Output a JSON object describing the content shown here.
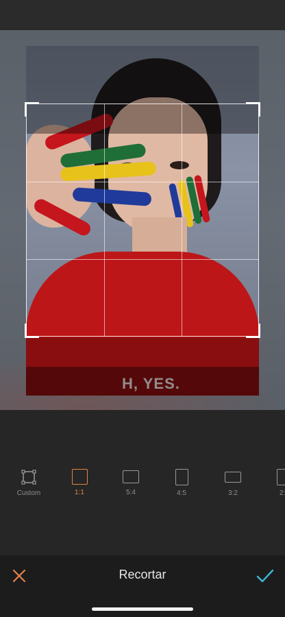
{
  "editor": {
    "photo_caption": "H, YES."
  },
  "ratios": [
    {
      "label": "Custom",
      "icon": "custom-crop-icon",
      "active": false
    },
    {
      "label": "1:1",
      "icon": "square-icon",
      "active": true
    },
    {
      "label": "5:4",
      "icon": "ratio-5-4-icon",
      "active": false
    },
    {
      "label": "4:5",
      "icon": "ratio-4-5-icon",
      "active": false
    },
    {
      "label": "3:2",
      "icon": "ratio-3-2-icon",
      "active": false
    },
    {
      "label": "2:",
      "icon": "ratio-2-3-icon",
      "active": false
    }
  ],
  "bottom_bar": {
    "title": "Recortar",
    "cancel_icon": "close-icon",
    "confirm_icon": "check-icon"
  },
  "colors": {
    "accent_active": "#e8844a",
    "confirm": "#3fb6d3",
    "cancel": "#e8844a"
  }
}
